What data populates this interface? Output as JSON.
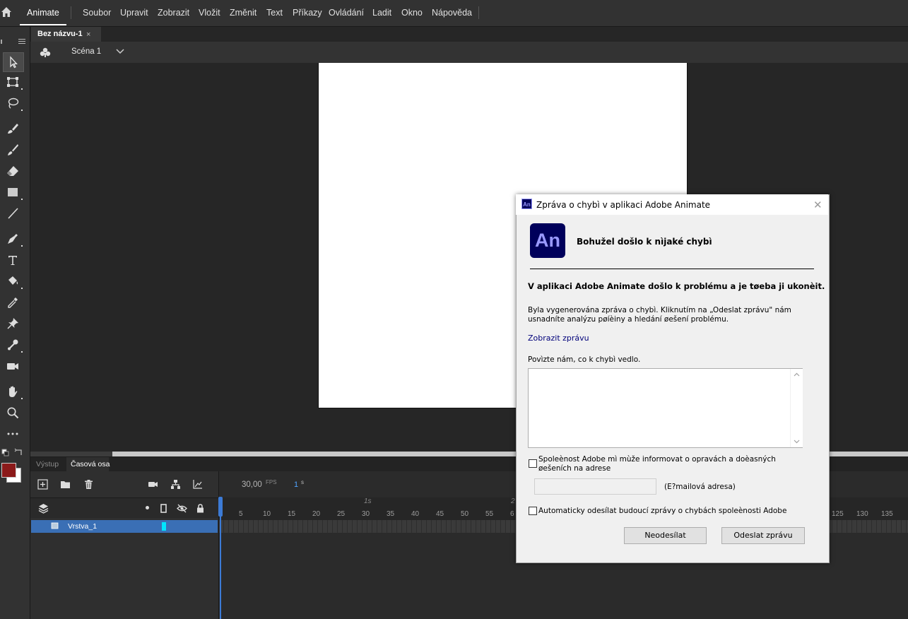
{
  "menubar": {
    "app_name": "Animate",
    "items": [
      "Soubor",
      "Upravit",
      "Zobrazit",
      "Vložit",
      "Změnit",
      "Text",
      "Příkazy",
      "Ovládání",
      "Ladit",
      "Okno",
      "Nápověda"
    ]
  },
  "document": {
    "tab_title": "Bez názvu-1",
    "tab_close": "×",
    "scene_label": "Scéna 1"
  },
  "panels": {
    "output_tab": "Výstup",
    "timeline_tab": "Časová osa"
  },
  "timeline": {
    "fps_value": "30,00",
    "fps_label": "FPS",
    "current_frame": "1",
    "frame_unit": "s",
    "ruler_seconds": [
      "1s",
      "2"
    ],
    "ruler_numbers": [
      "5",
      "10",
      "15",
      "20",
      "25",
      "30",
      "35",
      "40",
      "45",
      "50",
      "55",
      "6",
      "125",
      "130",
      "135"
    ],
    "layer_name": "Vrstva_1",
    "layer_color": "#00e5ff"
  },
  "colors": {
    "fill": "#8b1a1a",
    "stroke": "#ffffff"
  },
  "dialog": {
    "title": "Zpráva o chybì v aplikaci Adobe Animate",
    "icon_text": "An",
    "logo_text": "An",
    "heading": "Bohužel došlo k nìjaké chybì",
    "main_message": "V aplikaci Adobe Animate došlo k problému a je tøeba ji ukonèit.",
    "description": "Byla vygenerována zpráva o chybì. Kliknutím na „Odeslat zprávu\" nám usnadníte analýzu pøíèiny a hledání øešení problému.",
    "show_report_link": "Zobrazit zprávu",
    "tell_us_label": "Povìzte nám, co k chybì vedlo.",
    "tell_us_value": "",
    "notify_checkbox_label": "Spoleènost Adobe mì mùže informovat o opravách a doèasných øešeních na adrese",
    "email_label": "(E?mailová adresa)",
    "email_value": "",
    "auto_send_checkbox_label": "Automaticky odesílat budoucí zprávy o chybách spoleènosti Adobe",
    "dont_send_button": "Neodesílat",
    "send_button": "Odeslat zprávu"
  }
}
